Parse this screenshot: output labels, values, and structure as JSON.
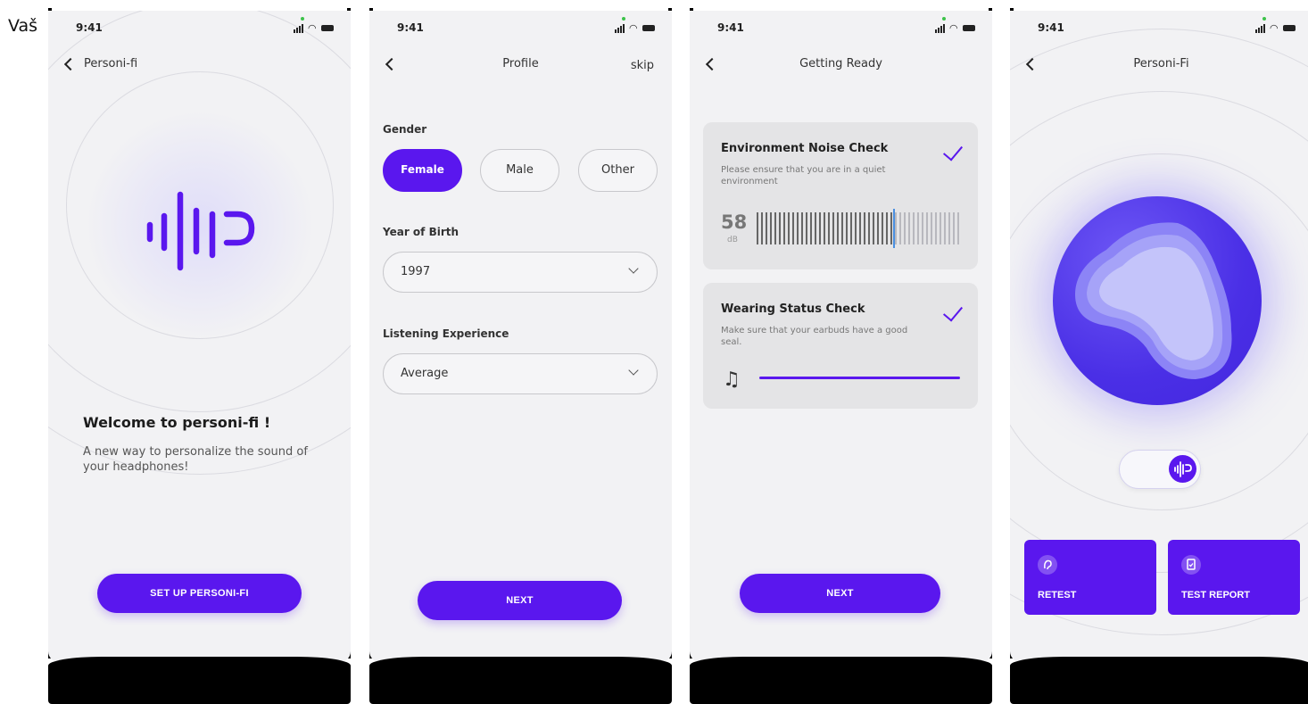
{
  "corner_text": "Vaš",
  "status_time": "9:41",
  "screens": {
    "welcome": {
      "title": "Personi-fi",
      "heading": "Welcome to personi-fi !",
      "subtitle": "A new way to personalize the sound of your headphones!",
      "cta": "SET UP PERSONI-FI"
    },
    "profile": {
      "title": "Profile",
      "skip": "skip",
      "gender_label": "Gender",
      "gender_options": [
        "Female",
        "Male",
        "Other"
      ],
      "gender_selected": "Female",
      "year_label": "Year of Birth",
      "year_value": "1997",
      "listening_label": "Listening Experience",
      "listening_value": "Average",
      "next": "NEXT"
    },
    "getting_ready": {
      "title": "Getting Ready",
      "noise_title": "Environment Noise Check",
      "noise_desc": "Please ensure that you are in a quiet environment",
      "noise_value": "58",
      "noise_unit": "dB",
      "noise_level_fraction": 0.68,
      "wearing_title": "Wearing Status Check",
      "wearing_desc": "Make sure that your earbuds have a good seal.",
      "next": "NEXT"
    },
    "result": {
      "title": "Personi-Fi",
      "retest": "RETEST",
      "report": "TEST REPORT"
    }
  },
  "colors": {
    "accent": "#5a17ee",
    "background": "#f2f2f4",
    "card": "#e4e4e6"
  }
}
